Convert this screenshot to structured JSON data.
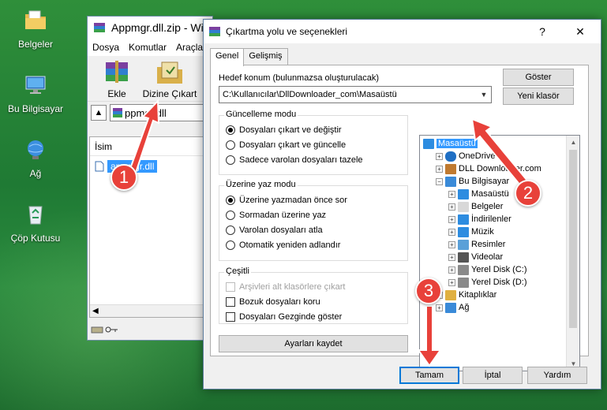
{
  "desktop": {
    "icons": [
      {
        "label": "Belgeler",
        "icon": "documents-folder-icon"
      },
      {
        "label": "Bu Bilgisayar",
        "icon": "computer-icon"
      },
      {
        "label": "Ağ",
        "icon": "network-icon"
      },
      {
        "label": "Çöp Kutusu",
        "icon": "recycle-bin-icon"
      }
    ]
  },
  "winrar": {
    "title": "Appmgr.dll.zip - Win",
    "menu": [
      "Dosya",
      "Komutlar",
      "Araçla"
    ],
    "tools": {
      "add_label": "Ekle",
      "extract_to_label": "Dizine Çıkart"
    },
    "path": "ppmgr.dll",
    "column_name": "İsim",
    "file": "appmgr.dll"
  },
  "dialog": {
    "title": "Çıkartma yolu ve seçenekleri",
    "help": "?",
    "close": "✕",
    "tabs": [
      "Genel",
      "Gelişmiş"
    ],
    "destination_label": "Hedef konum (bulunmazsa oluşturulacak)",
    "destination_value": "C:\\Kullanıcılar\\DllDownloader_com\\Masaüstü",
    "show_button": "Göster",
    "new_folder_button": "Yeni klasör",
    "update_mode": {
      "title": "Güncelleme modu",
      "options": [
        "Dosyaları çıkart ve değiştir",
        "Dosyaları çıkart ve güncelle",
        "Sadece varolan dosyaları tazele"
      ],
      "selected": 0
    },
    "overwrite_mode": {
      "title": "Üzerine yaz modu",
      "options": [
        "Üzerine yazmadan önce sor",
        "Sormadan üzerine yaz",
        "Varolan dosyaları atla",
        "Otomatik yeniden adlandır"
      ],
      "selected": 0
    },
    "misc": {
      "title": "Çeşitli",
      "options": [
        {
          "label": "Arşivleri alt klasörlere çıkart",
          "checked": false,
          "disabled": true
        },
        {
          "label": "Bozuk dosyaları koru",
          "checked": false,
          "disabled": false
        },
        {
          "label": "Dosyaları Gezginde göster",
          "checked": false,
          "disabled": false
        }
      ]
    },
    "save_settings_button": "Ayarları kaydet",
    "tree": [
      {
        "label": "Masaüstü",
        "level": 0,
        "selected": true,
        "expander": "",
        "icon": "desktop-icon"
      },
      {
        "label": "OneDrive",
        "level": 1,
        "selected": false,
        "expander": "+",
        "icon": "onedrive-icon"
      },
      {
        "label": "DLL Downloader.com",
        "level": 1,
        "selected": false,
        "expander": "+",
        "icon": "user-icon"
      },
      {
        "label": "Bu Bilgisayar",
        "level": 1,
        "selected": false,
        "expander": "−",
        "icon": "computer-icon"
      },
      {
        "label": "Masaüstü",
        "level": 2,
        "selected": false,
        "expander": "+",
        "icon": "desktop-icon"
      },
      {
        "label": "Belgeler",
        "level": 2,
        "selected": false,
        "expander": "+",
        "icon": "documents-icon"
      },
      {
        "label": "İndirilenler",
        "level": 2,
        "selected": false,
        "expander": "+",
        "icon": "downloads-icon"
      },
      {
        "label": "Müzik",
        "level": 2,
        "selected": false,
        "expander": "+",
        "icon": "music-icon"
      },
      {
        "label": "Resimler",
        "level": 2,
        "selected": false,
        "expander": "+",
        "icon": "pictures-icon"
      },
      {
        "label": "Videolar",
        "level": 2,
        "selected": false,
        "expander": "+",
        "icon": "videos-icon"
      },
      {
        "label": "Yerel Disk (C:)",
        "level": 2,
        "selected": false,
        "expander": "+",
        "icon": "drive-icon"
      },
      {
        "label": "Yerel Disk (D:)",
        "level": 2,
        "selected": false,
        "expander": "+",
        "icon": "drive-icon"
      },
      {
        "label": "Kitaplıklar",
        "level": 1,
        "selected": false,
        "expander": "+",
        "icon": "libraries-icon"
      },
      {
        "label": "Ağ",
        "level": 1,
        "selected": false,
        "expander": "+",
        "icon": "network-icon"
      }
    ],
    "buttons": {
      "ok": "Tamam",
      "cancel": "İptal",
      "help": "Yardım"
    }
  },
  "callouts": [
    "1",
    "2",
    "3"
  ],
  "colors": {
    "callout": "#e8413a",
    "selection": "#3399ff",
    "desktop": "#2a8a3e"
  }
}
